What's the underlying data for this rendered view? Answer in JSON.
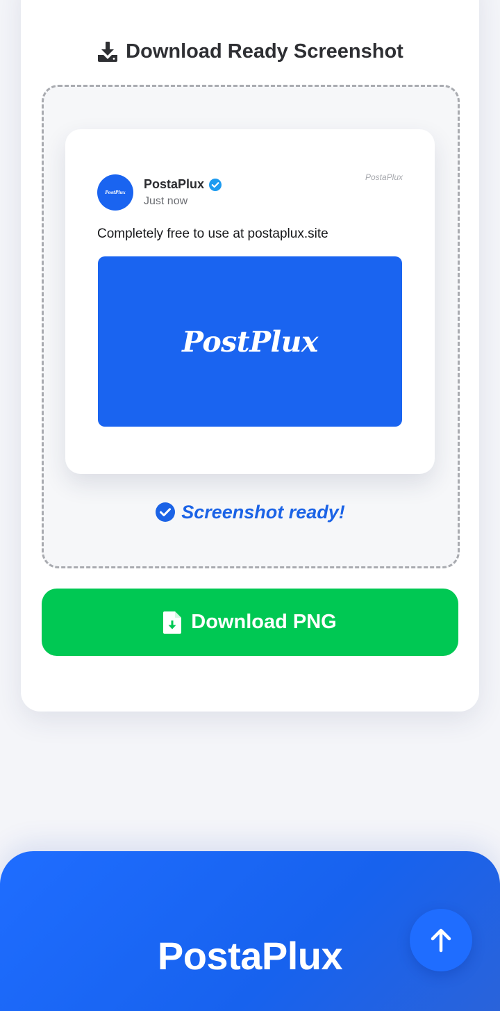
{
  "section": {
    "title": "Download Ready Screenshot"
  },
  "post_preview": {
    "avatar_text": "PostPlux",
    "author_name": "PostaPlux",
    "timestamp": "Just now",
    "watermark": "PostaPlux",
    "text": "Completely free to use at postaplux.site",
    "image_logo": "PostPlux",
    "verified_icon": "verified-badge-icon"
  },
  "status": {
    "text": "Screenshot ready!",
    "icon": "check-circle-icon"
  },
  "download_button": {
    "label": "Download PNG",
    "icon": "file-download-icon"
  },
  "footer": {
    "brand": "PostaPlux"
  },
  "scroll_top": {
    "icon": "arrow-up-icon"
  },
  "colors": {
    "accent_blue": "#1a64f0",
    "success_green": "#00c853",
    "footer_blue": "#1f6dff",
    "title_text": "#2e2f33"
  }
}
